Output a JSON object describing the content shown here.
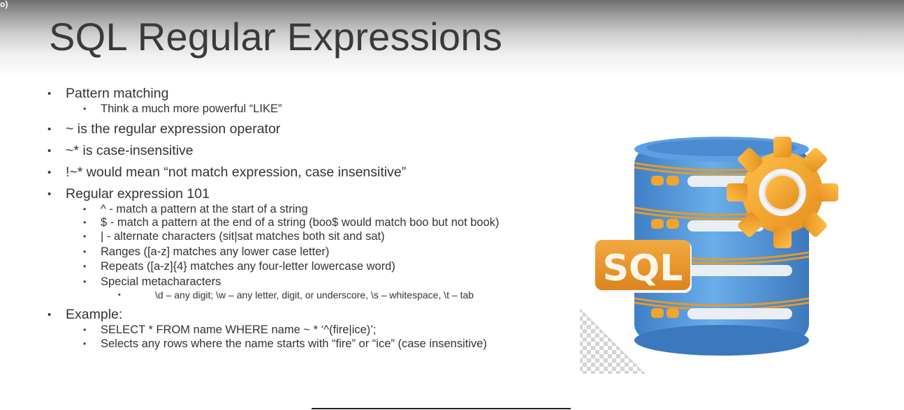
{
  "corner_label": "o)",
  "title": "SQL Regular Expressions",
  "bullets": {
    "pattern_matching": "Pattern matching",
    "think_like": "Think a much more powerful “LIKE”",
    "tilde": "~ is the regular expression operator",
    "tilde_star": "~* is case-insensitive",
    "not_match": "!~* would mean “not match expression, case insensitive”",
    "regex_101": "Regular expression 101",
    "caret": "^ - match a pattern at the start of a string",
    "dollar": "$ - match a pattern at the end of a string (boo$ would match boo but not book)",
    "pipe": "| - alternate characters (sit|sat matches both sit and sat)",
    "ranges": "Ranges ([a-z] matches any lower case letter)",
    "repeats": "Repeats ([a-z]{4} matches any four-letter lowercase word)",
    "special": "Special metacharacters",
    "metachars": "\\d – any digit; \\w – any letter, digit, or underscore, \\s – whitespace, \\t – tab",
    "example": "Example:",
    "select": "SELECT * FROM name WHERE name ~ * ‘^(fire|ice)’;",
    "selects_rows": "Selects any rows where the name starts with “fire” or “ice” (case insensitive)"
  },
  "illustration": {
    "badge_text": "SQL",
    "icon": "database-gear-icon",
    "colors": {
      "database_blue": "#4a90d9",
      "gear_orange": "#f0a830",
      "badge_orange": "#e8982a"
    }
  }
}
